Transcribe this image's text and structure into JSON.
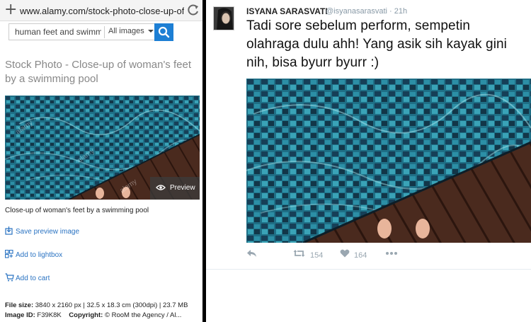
{
  "browser": {
    "url": "www.alamy.com/stock-photo-close-up-of",
    "search_query": "human feet and swimming",
    "search_filter": "All images"
  },
  "alamy": {
    "title": "Stock Photo - Close-up of woman's feet by a swimming pool",
    "preview_label": "Preview",
    "caption": "Close-up of woman's feet by a swimming pool",
    "actions": [
      {
        "label": "Save preview image",
        "icon": "save-icon"
      },
      {
        "label": "Add to lightbox",
        "icon": "lightbox-icon"
      },
      {
        "label": "Add to cart",
        "icon": "cart-icon"
      }
    ],
    "file_size_label": "File size:",
    "file_size_value": "3840 x 2160 px | 32.5 x 18.3 cm (300dpi) | 23.7 MB",
    "image_id_label": "Image ID:",
    "image_id_value": "F39K8K",
    "copyright_label": "Copyright:",
    "copyright_value": "© RooM the Agency / Al...",
    "watermark": "alamy"
  },
  "tweet": {
    "display_name": "ISYANA SARASVATI",
    "handle_time": "@isyanasarasvati · 21h",
    "text": "Tadi sore sebelum perform, sempetin olahraga dulu ahh! Yang asik sih kayak gini nih, bisa byurr byurr :)",
    "retweets": "154",
    "likes": "164",
    "actions": [
      "reply-icon",
      "retweet-icon",
      "like-icon",
      "more-icon"
    ]
  },
  "colors": {
    "link_blue": "#2a73c2",
    "search_button": "#1d7fd4",
    "pool_water": "#1f6f86",
    "deck_wood": "#4a2a1e",
    "twitter_gray": "#9aa7b1"
  }
}
